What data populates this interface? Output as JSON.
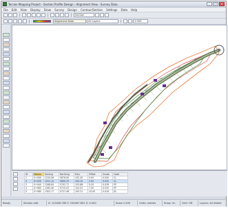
{
  "window": {
    "title": "Terrain Mapping Project - Section Profile Design - Alignment View - Survey Data",
    "minimize": "_",
    "maximize": "□",
    "close": "×"
  },
  "menu": [
    "File",
    "Edit",
    "View",
    "Display",
    "Draw",
    "Survey",
    "Design",
    "Contour/Section",
    "Settings",
    "Data",
    "Help"
  ],
  "toolbar": {
    "field1": "Section",
    "field2": "Alignment Data",
    "field3": "All Layers",
    "field4": "1:500"
  },
  "table": {
    "columns": [
      "ID",
      "Station",
      "Easting",
      "Northing",
      "Elev.",
      "Offset",
      "Grade",
      "Code"
    ],
    "rows": [
      [
        "1",
        "0+000",
        "1234.56",
        "5678.90",
        "102.45",
        "0.00",
        "0.000",
        "CL"
      ],
      [
        "2",
        "0+020",
        "1251.12",
        "5690.33",
        "103.10",
        "2.50",
        "0.032",
        "CL"
      ],
      [
        "3",
        "0+040",
        "1268.84",
        "5702.71",
        "103.88",
        "5.00",
        "0.039",
        "EP"
      ],
      [
        "4",
        "0+060",
        "1285.40",
        "5715.02",
        "104.52",
        "7.50",
        "0.032",
        "EP"
      ],
      [
        "5",
        "0+080",
        "1302.77",
        "5727.46",
        "105.21",
        "10.00",
        "0.034",
        "DL"
      ]
    ]
  },
  "status": {
    "ready": "Ready",
    "mode": "Section edit",
    "coords": "X: 123456.789  Y: 234567.891  Z: 0.000",
    "scale": "Scale 1:500",
    "units": "Units: metres",
    "snap": "Snap: On",
    "grid": "Grid: Off",
    "layers": "Layers: All Visible"
  },
  "colors": {
    "alignment": "#6b7f5a",
    "contour_orange": "#e07a3a",
    "contour_red": "#d24a4a",
    "contour_green": "#3a8a3a",
    "marker": "#6a2d8f"
  }
}
